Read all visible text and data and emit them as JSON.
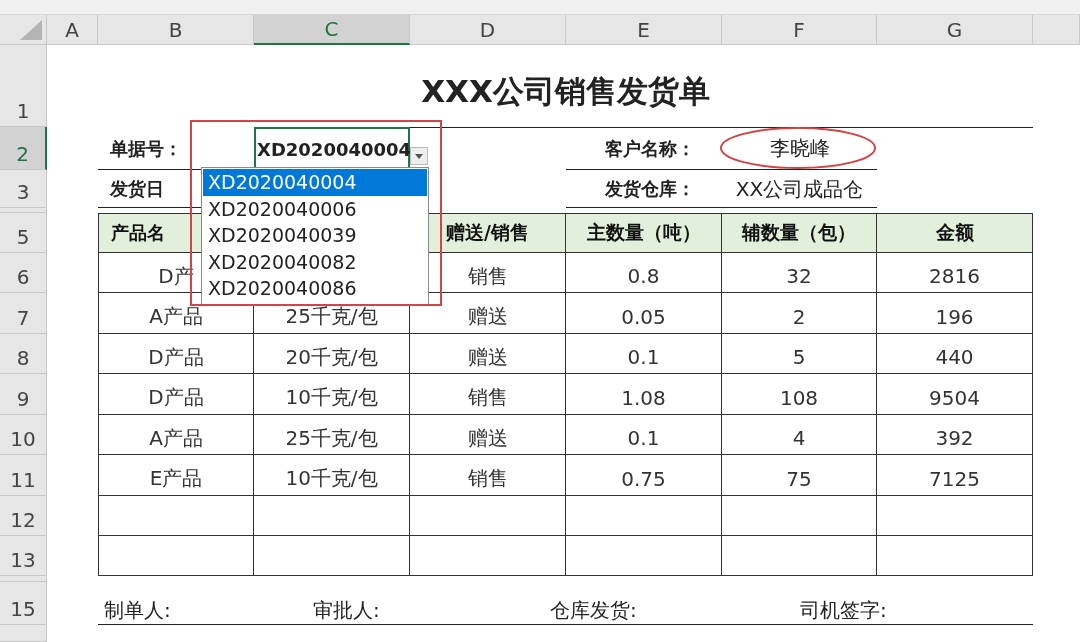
{
  "columns": [
    {
      "label": "A",
      "selected": false
    },
    {
      "label": "B",
      "selected": false
    },
    {
      "label": "C",
      "selected": true
    },
    {
      "label": "D",
      "selected": false
    },
    {
      "label": "E",
      "selected": false
    },
    {
      "label": "F",
      "selected": false
    },
    {
      "label": "G",
      "selected": false
    }
  ],
  "row_headers": [
    {
      "label": "1",
      "selected": false
    },
    {
      "label": "2",
      "selected": true
    },
    {
      "label": "3",
      "selected": false
    },
    {
      "label": "5",
      "selected": false
    },
    {
      "label": "6",
      "selected": false
    },
    {
      "label": "7",
      "selected": false
    },
    {
      "label": "8",
      "selected": false
    },
    {
      "label": "9",
      "selected": false
    },
    {
      "label": "10",
      "selected": false
    },
    {
      "label": "11",
      "selected": false
    },
    {
      "label": "12",
      "selected": false
    },
    {
      "label": "13",
      "selected": false
    },
    {
      "label": "15",
      "selected": false
    }
  ],
  "title": "XXX公司销售发货单",
  "order_number": {
    "label": "单据号：",
    "value": "XD2020040004"
  },
  "ship_date": {
    "label": "发货日"
  },
  "customer": {
    "label": "客户名称：",
    "value": "李晓峰",
    "circled": true
  },
  "warehouse": {
    "label": "发货仓库：",
    "value": "XX公司成品仓"
  },
  "table": {
    "header": [
      "产品名",
      "赠送/销售",
      "主数量（吨）",
      "辅数量（包）",
      "金额"
    ],
    "rows": [
      [
        "D产",
        "",
        "销售",
        "0.8",
        "32",
        "2816"
      ],
      [
        "A产品",
        "25千克/包",
        "赠送",
        "0.05",
        "2",
        "196"
      ],
      [
        "D产品",
        "20千克/包",
        "赠送",
        "0.1",
        "5",
        "440"
      ],
      [
        "D产品",
        "10千克/包",
        "销售",
        "1.08",
        "108",
        "9504"
      ],
      [
        "A产品",
        "25千克/包",
        "赠送",
        "0.1",
        "4",
        "392"
      ],
      [
        "E产品",
        "10千克/包",
        "销售",
        "0.75",
        "75",
        "7125"
      ]
    ]
  },
  "footer": [
    "制单人:",
    "审批人:",
    "仓库发货:",
    "司机签字:"
  ],
  "dropdown": {
    "open": true,
    "options": [
      {
        "label": "XD2020040004",
        "selected": true
      },
      {
        "label": "XD2020040006",
        "selected": false
      },
      {
        "label": "XD2020040039",
        "selected": false
      },
      {
        "label": "XD2020040082",
        "selected": false
      },
      {
        "label": "XD2020040086",
        "selected": false
      }
    ]
  }
}
